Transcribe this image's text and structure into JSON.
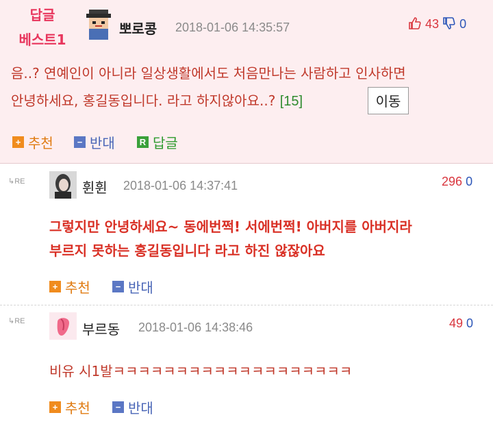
{
  "best_comment": {
    "tag_line1": "답글",
    "tag_line2": "베스트1",
    "author": "뽀로콩",
    "date": "2018-01-06 14:35:57",
    "up_votes": "43",
    "down_votes": "0",
    "text_line1": "음..? 연예인이 아니라 일상생활에서도 처음만나는 사람하고 인사하면",
    "text_line2": "안녕하세요, 홍길동입니다. 라고 하지않아요..?",
    "reply_count": "[15]",
    "move_button": "이동",
    "recommend": "추천",
    "oppose": "반대",
    "reply": "답글"
  },
  "replies": [
    {
      "re_label": "RE",
      "author": "휜휜",
      "date": "2018-01-06 14:37:41",
      "up_votes": "296",
      "down_votes": "0",
      "text_line1": "그렇지만 안녕하세요~ 동에번쩍! 서에번쩍! 아버지를 아버지라",
      "text_line2": "부르지 못하는 홍길동입니다 라고 하진 않잖아요",
      "recommend": "추천",
      "oppose": "반대"
    },
    {
      "re_label": "RE",
      "author": "부르동",
      "date": "2018-01-06 14:38:46",
      "up_votes": "49",
      "down_votes": "0",
      "text_line1": "비유 시1발ㅋㅋㅋㅋㅋㅋㅋㅋㅋㅋㅋㅋㅋㅋㅋㅋㅋㅋㅋ",
      "recommend": "추천",
      "oppose": "반대"
    }
  ],
  "colors": {
    "best_bg": "#fdeef0",
    "accent_pink": "#e8365d",
    "text_red": "#c0392b",
    "up_red": "#d9363e",
    "down_blue": "#2c56b8"
  }
}
